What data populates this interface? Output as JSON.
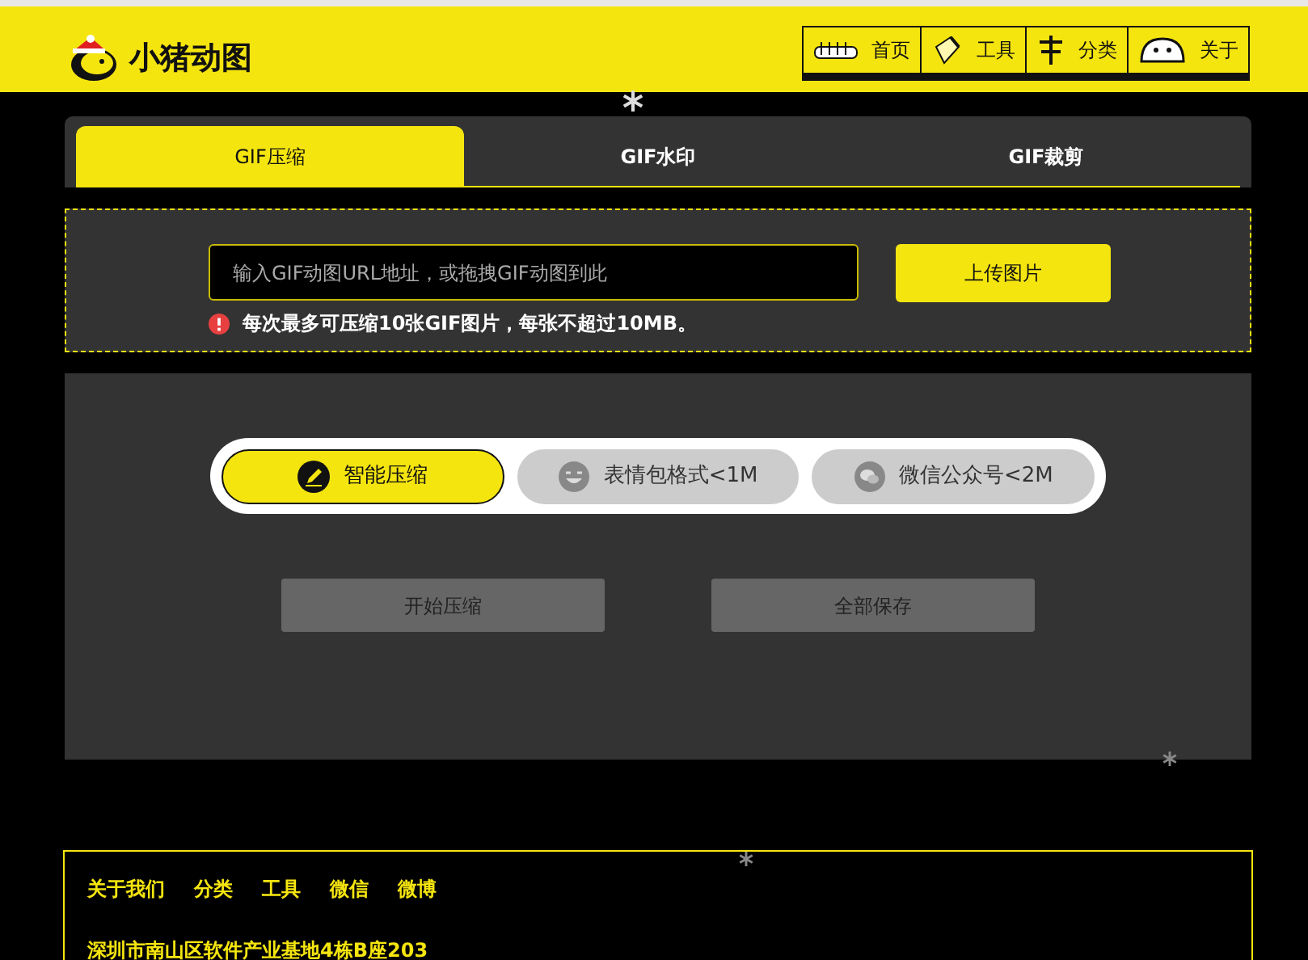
{
  "logo": {
    "text": "小猪动图"
  },
  "nav": [
    {
      "label": "首页",
      "kind": "home"
    },
    {
      "label": "工具",
      "kind": "tool"
    },
    {
      "label": "分类",
      "kind": "category"
    },
    {
      "label": "关于",
      "kind": "about"
    }
  ],
  "tabs": [
    {
      "label": "GIF压缩",
      "selected": true
    },
    {
      "label": "GIF水印",
      "selected": false
    },
    {
      "label": "GIF裁剪",
      "selected": false
    }
  ],
  "upload": {
    "placeholder": "输入GIF动图URL地址，或拖拽GIF动图到此",
    "button": "上传图片",
    "notice": "每次最多可压缩10张GIF图片，每张不超过10MB。"
  },
  "modes": [
    {
      "label": "智能压缩",
      "kind": "smart",
      "selected": true
    },
    {
      "label": "表情包格式<1M",
      "kind": "emoji",
      "selected": false
    },
    {
      "label": "微信公众号<2M",
      "kind": "wechat",
      "selected": false
    }
  ],
  "actions": [
    "开始压缩",
    "全部保存"
  ],
  "footer": {
    "links": [
      "关于我们",
      "分类",
      "工具",
      "微信",
      "微博"
    ],
    "address": "深圳市南山区软件产业基地4栋B座203"
  }
}
